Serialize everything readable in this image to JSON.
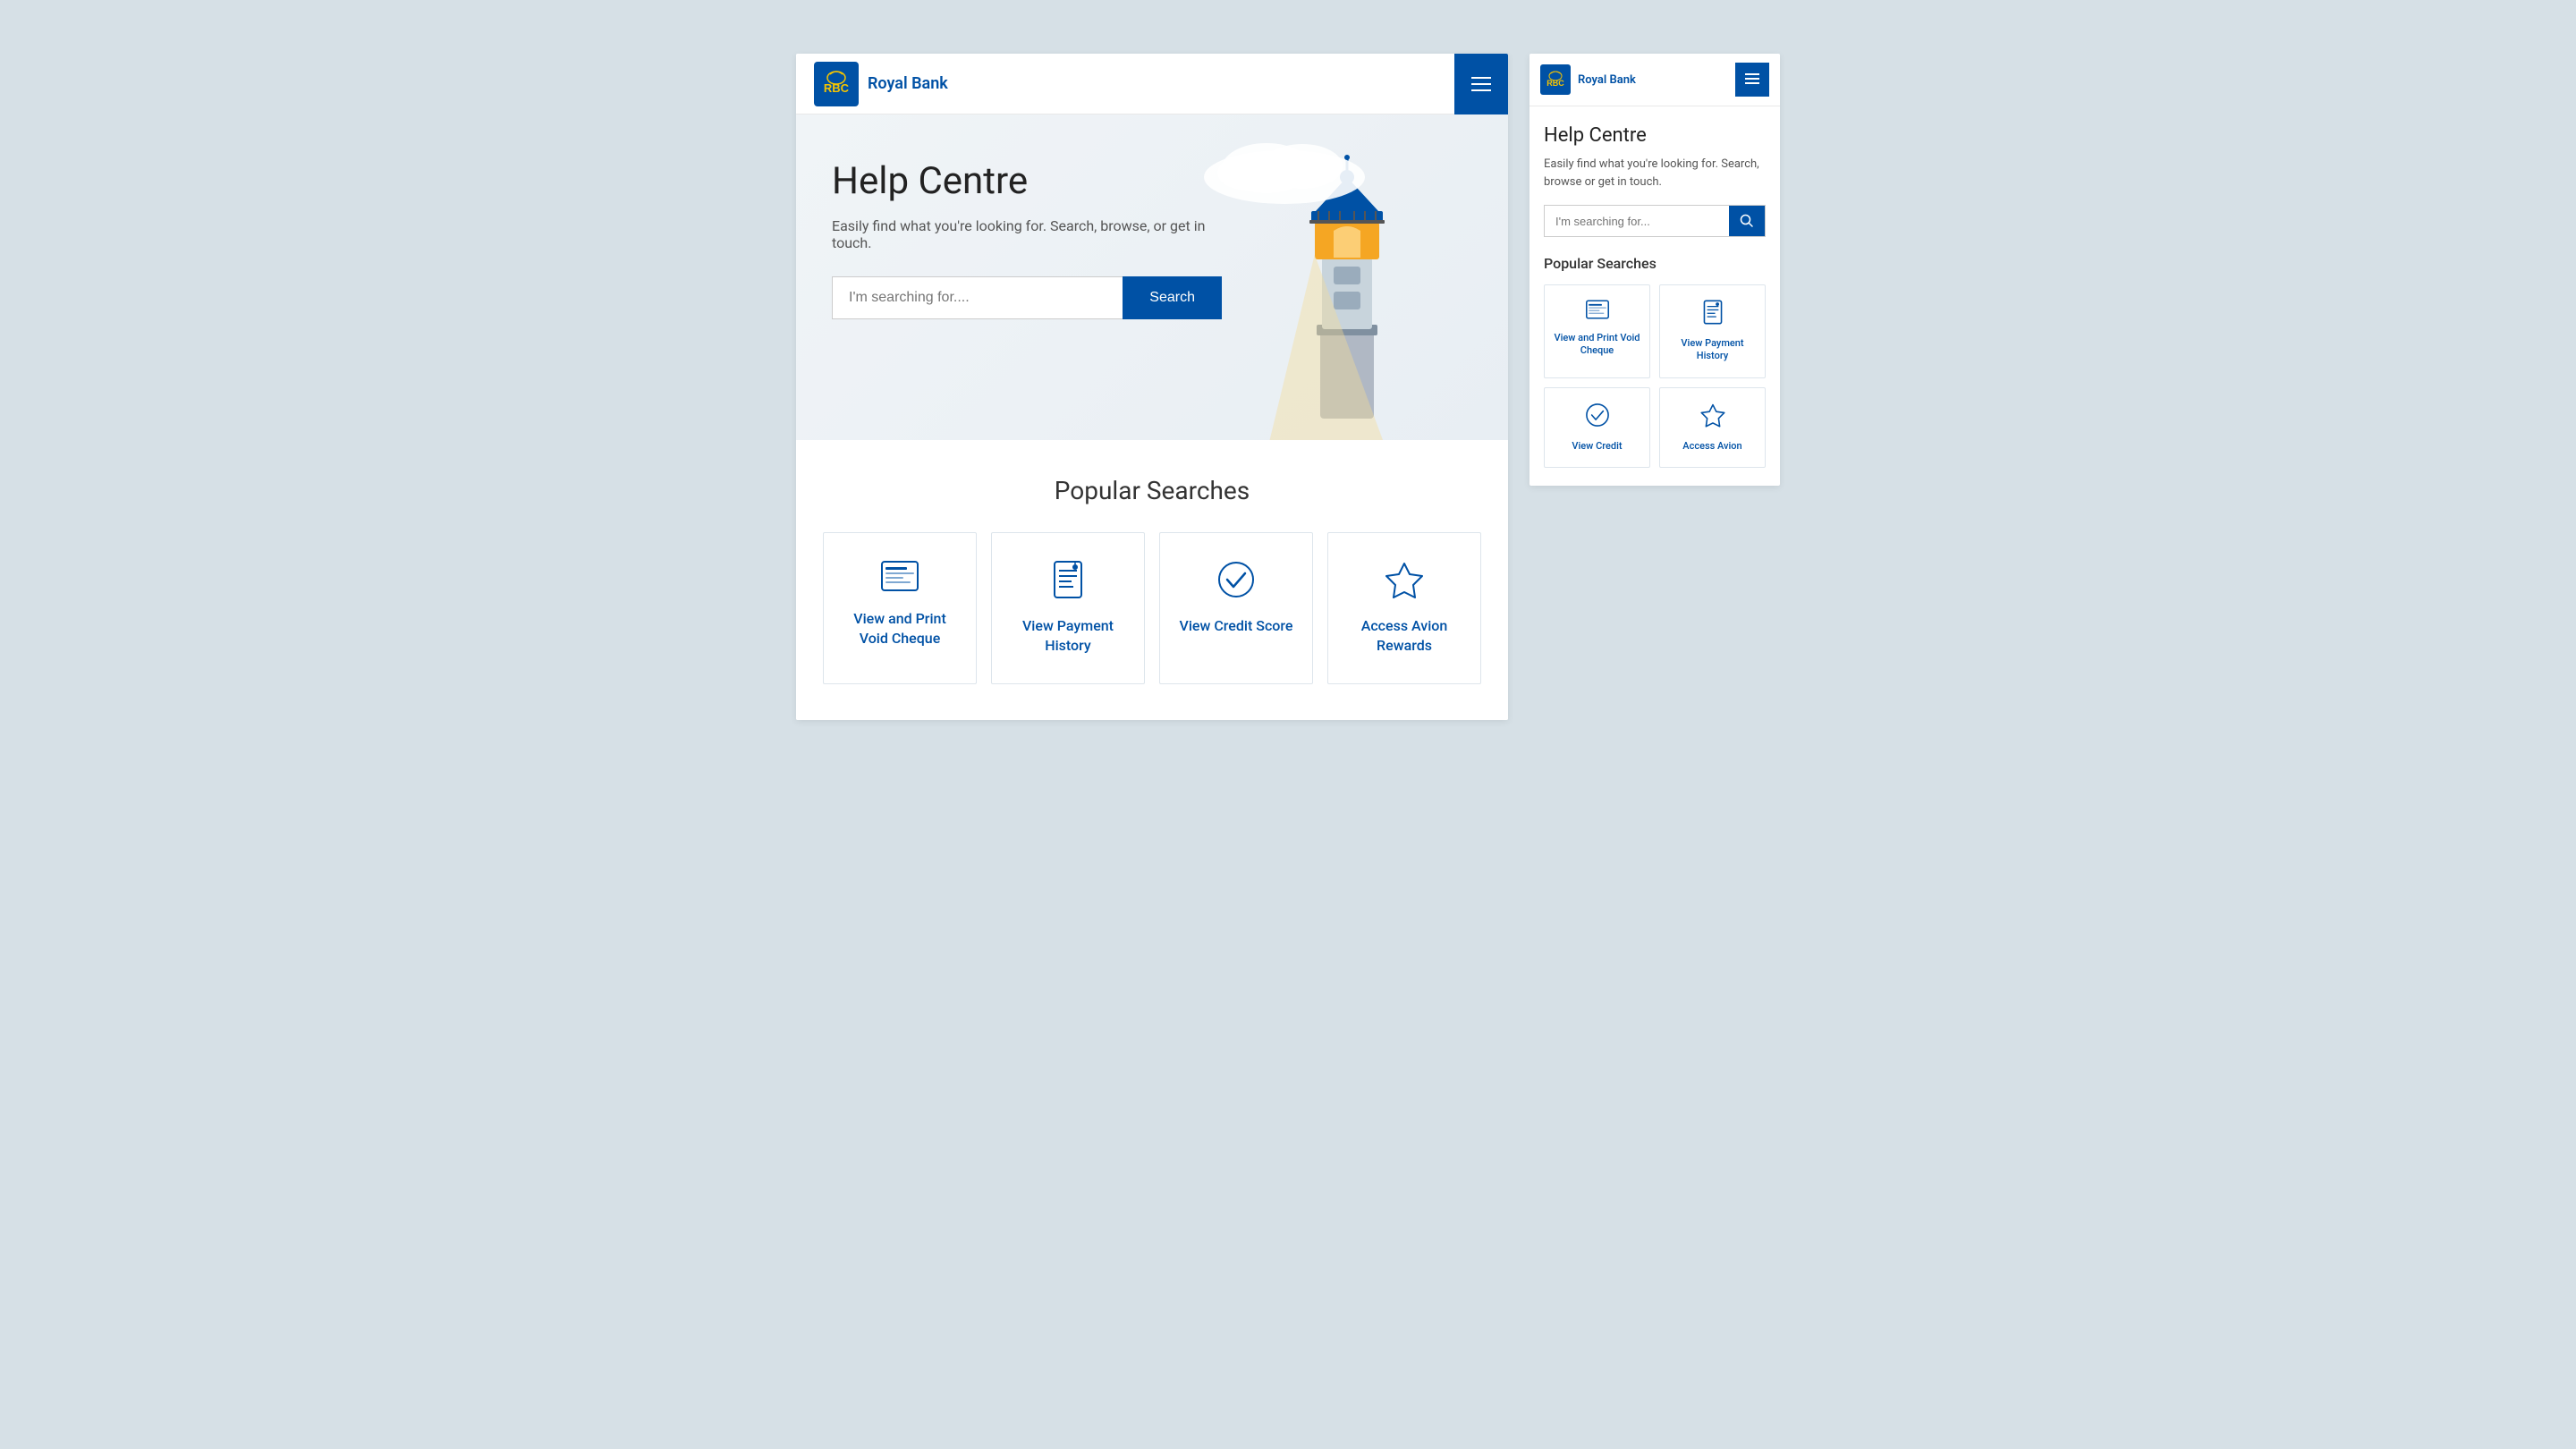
{
  "header": {
    "bank_name": "Royal Bank",
    "menu_aria": "Menu"
  },
  "hero": {
    "title": "Help Centre",
    "subtitle": "Easily find what you're looking for. Search, browse, or get in touch.",
    "search_placeholder": "I'm searching for....",
    "search_button": "Search"
  },
  "popular": {
    "title": "Popular Searches",
    "cards": [
      {
        "id": "void-cheque",
        "label": "View and Print Void Cheque",
        "icon_type": "cheque"
      },
      {
        "id": "payment-history",
        "label": "View Payment History",
        "icon_type": "payment"
      },
      {
        "id": "credit-score",
        "label": "View Credit Score",
        "icon_type": "credit"
      },
      {
        "id": "avion-rewards",
        "label": "Access Avion Rewards",
        "icon_type": "diamond"
      }
    ]
  },
  "side": {
    "header": {
      "bank_name": "Royal Bank"
    },
    "hero": {
      "title": "Help Centre",
      "subtitle": "Easily find what you're looking for. Search, browse or get in touch.",
      "search_placeholder": "I'm searching for...",
      "search_button_aria": "Search"
    },
    "popular": {
      "title": "Popular Searches",
      "cards": [
        {
          "id": "void-cheque-side",
          "label": "View and Print Void Cheque",
          "icon_type": "cheque"
        },
        {
          "id": "payment-history-side",
          "label": "View Payment History",
          "icon_type": "payment"
        },
        {
          "id": "credit-side",
          "label": "View Credit",
          "icon_type": "credit"
        },
        {
          "id": "avion-side",
          "label": "Access Avion",
          "icon_type": "diamond"
        }
      ]
    }
  }
}
